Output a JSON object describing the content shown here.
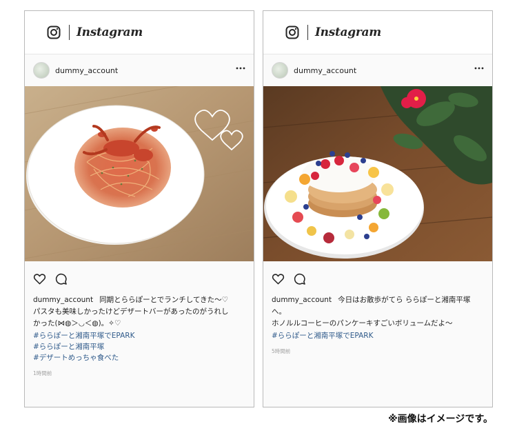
{
  "brand": {
    "wordmark": "Instagram"
  },
  "posts": [
    {
      "username": "dummy_account",
      "caption_user": "dummy_account",
      "caption_lines": [
        "同期とららぽーとでランチしてきた～♡",
        "パスタも美味しかったけどデザートバーがあったのがうれし",
        "かった(⋈◍＞◡＜◍)。✧♡"
      ],
      "hashtags": [
        "#ららぽーと湘南平塚でEPARK",
        "#ららぽーと湘南平塚",
        "#デザートめっちゃ食べた"
      ],
      "timestamp": "1時間前",
      "photo_icon": "pasta-with-crab-photo"
    },
    {
      "username": "dummy_account",
      "caption_user": "dummy_account",
      "caption_lines": [
        "今日はお散歩がてら ららぽーと湘南平塚へ。",
        "ホノルルコーヒーのパンケーキすごいボリュームだよ～"
      ],
      "hashtags": [
        "#ららぽーと湘南平塚でEPARK"
      ],
      "timestamp": "5時間前",
      "photo_icon": "pancake-with-fruit-photo"
    }
  ],
  "footnote": "※画像はイメージです。"
}
